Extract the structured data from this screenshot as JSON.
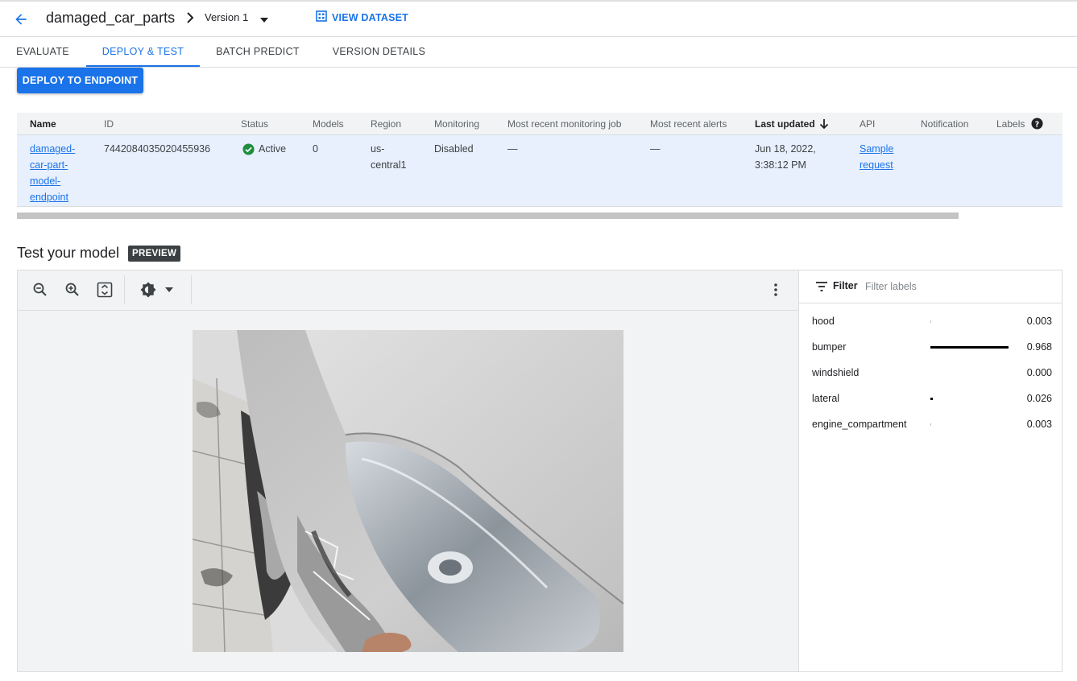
{
  "header": {
    "title": "damaged_car_parts",
    "version": "Version 1",
    "view_dataset": "VIEW DATASET"
  },
  "tabs": [
    {
      "label": "EVALUATE",
      "active": false
    },
    {
      "label": "DEPLOY & TEST",
      "active": true
    },
    {
      "label": "BATCH PREDICT",
      "active": false
    },
    {
      "label": "VERSION DETAILS",
      "active": false
    }
  ],
  "deploy_button": "DEPLOY TO ENDPOINT",
  "endpoints_table": {
    "columns": [
      "Name",
      "ID",
      "Status",
      "Models",
      "Region",
      "Monitoring",
      "Most recent monitoring job",
      "Most recent alerts",
      "Last updated",
      "API",
      "Notification",
      "Labels"
    ],
    "row": {
      "name": "damaged-car-part-model-endpoint",
      "name_lines": [
        "damaged-",
        "car-part-",
        "model-",
        "endpoint"
      ],
      "id": "7442084035020455936",
      "status": "Active",
      "models": "0",
      "region_lines": [
        "us-",
        "central1"
      ],
      "monitoring": "Disabled",
      "recent_job": "—",
      "recent_alerts": "—",
      "last_updated_lines": [
        "Jun 18, 2022,",
        "3:38:12 PM"
      ],
      "api_lines": [
        "Sample",
        "request"
      ]
    }
  },
  "test_section": {
    "title": "Test your model",
    "badge": "PREVIEW"
  },
  "filter": {
    "label": "Filter",
    "placeholder": "Filter labels"
  },
  "predictions": [
    {
      "label": "hood",
      "score": 0.003,
      "display": "0.003"
    },
    {
      "label": "bumper",
      "score": 0.968,
      "display": "0.968"
    },
    {
      "label": "windshield",
      "score": 0.0,
      "display": "0.000"
    },
    {
      "label": "lateral",
      "score": 0.026,
      "display": "0.026"
    },
    {
      "label": "engine_compartment",
      "score": 0.003,
      "display": "0.003"
    }
  ],
  "colors": {
    "accent": "#1a73e8",
    "status_ok": "#1e8e3e",
    "row_highlight": "#e8f0fe"
  },
  "icons": {
    "back": "arrow-back-icon",
    "breadcrumb": "chevron-right-icon",
    "dataset": "grid-icon",
    "zoom_out": "zoom-out-icon",
    "zoom_in": "zoom-in-icon",
    "fit": "fit-screen-icon",
    "brightness": "brightness-icon",
    "more": "more-vert-icon",
    "filter": "filter-list-icon",
    "help": "help-icon",
    "sort": "arrow-down-icon",
    "status": "check-circle-icon"
  }
}
